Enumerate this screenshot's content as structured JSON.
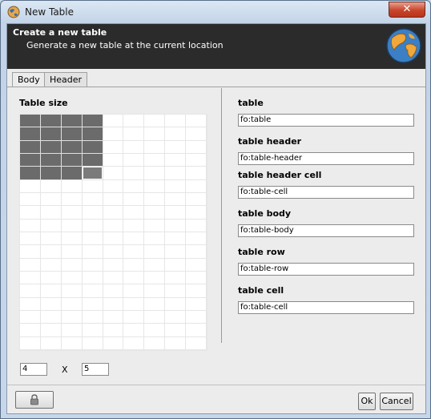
{
  "window": {
    "title": "New Table",
    "close_label": "✕"
  },
  "banner": {
    "title": "Create a new table",
    "subtitle": "Generate a new table at the current location"
  },
  "tabs": [
    {
      "label": "Body",
      "active": true
    },
    {
      "label": "Header",
      "active": false
    }
  ],
  "table_size": {
    "label": "Table size",
    "rows_value": "4",
    "separator": "X",
    "cols_value": "5",
    "grid_columns": 9,
    "grid_rows": 18,
    "selected_columns": 4,
    "selected_rows": 5
  },
  "fields": [
    {
      "key": "table",
      "label": "table",
      "value": "fo:table"
    },
    {
      "key": "table_header",
      "label": "table header",
      "value": "fo:table-header"
    },
    {
      "key": "table_header_cell",
      "label": "table header cell",
      "value": "fo:table-cell"
    },
    {
      "key": "table_body",
      "label": "table body",
      "value": "fo:table-body"
    },
    {
      "key": "table_row",
      "label": "table row",
      "value": "fo:table-row"
    },
    {
      "key": "table_cell",
      "label": "table cell",
      "value": "fo:table-cell"
    }
  ],
  "buttons": {
    "ok": "Ok",
    "cancel": "Cancel",
    "lock_icon": "lock-icon"
  },
  "colors": {
    "banner_bg": "#2b2b2b",
    "selected_cell": "#6b6b6b",
    "dialog_bg": "#ececec"
  }
}
